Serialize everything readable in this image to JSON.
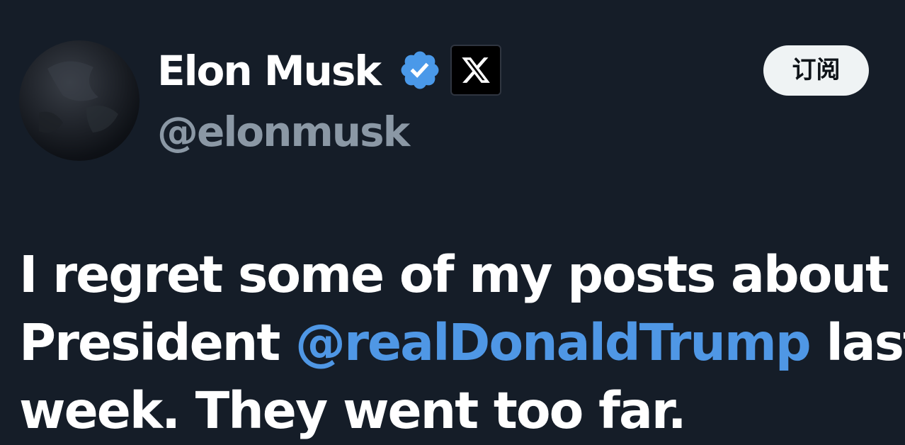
{
  "tweet": {
    "author": {
      "display_name": "Elon Musk",
      "handle": "@elonmusk",
      "avatar_icon": "dark-avatar",
      "verified_icon": "verified-check-icon",
      "affiliation_icon": "x-logo-icon"
    },
    "subscribe_label": "订阅",
    "text": {
      "line1": "I regret some of my posts about",
      "line2_prefix": "President ",
      "mention": "@realDonaldTrump",
      "line2_suffix": " last",
      "line3": "week. They went too far."
    }
  },
  "colors": {
    "background": "#151d28",
    "primary_text": "#ffffff",
    "secondary_text": "#8b98a5",
    "mention": "#4f97e5",
    "verified_badge": "#4a99e9",
    "subscribe_button_bg": "#eff3f4",
    "subscribe_button_text": "#0f1419"
  }
}
